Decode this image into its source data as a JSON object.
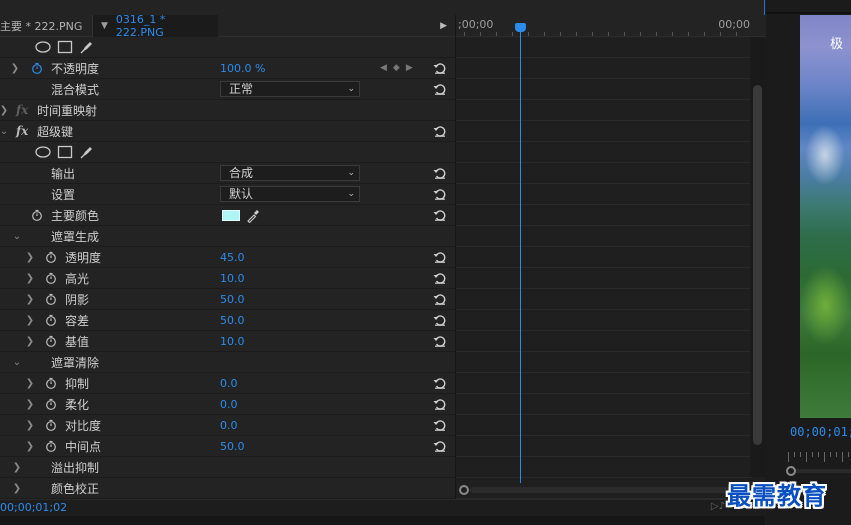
{
  "header": {
    "master_label": "主要 * 222.PNG",
    "clip_label": "0316_1 * 222.PNG"
  },
  "timeline": {
    "start_time": ";00;00",
    "end_time": "00;00"
  },
  "effects": {
    "opacity": {
      "label": "不透明度",
      "value": "100.0 %",
      "blend_label": "混合模式",
      "blend_value": "正常"
    },
    "time_remap": {
      "label": "时间重映射"
    },
    "ultra_key": {
      "label": "超级键",
      "output_label": "输出",
      "output_value": "合成",
      "setting_label": "设置",
      "setting_value": "默认",
      "key_color_label": "主要颜色",
      "key_color": "#aef6f6",
      "matte_gen": {
        "label": "遮罩生成",
        "params": [
          {
            "label": "透明度",
            "value": "45.0"
          },
          {
            "label": "高光",
            "value": "10.0"
          },
          {
            "label": "阴影",
            "value": "50.0"
          },
          {
            "label": "容差",
            "value": "50.0"
          },
          {
            "label": "基值",
            "value": "10.0"
          }
        ]
      },
      "matte_cleanup": {
        "label": "遮罩清除",
        "params": [
          {
            "label": "抑制",
            "value": "0.0"
          },
          {
            "label": "柔化",
            "value": "0.0"
          },
          {
            "label": "对比度",
            "value": "0.0"
          },
          {
            "label": "中间点",
            "value": "50.0"
          }
        ]
      },
      "spill_label": "溢出抑制",
      "color_correction_label": "颜色校正"
    }
  },
  "footer": {
    "timecode": "00;00;01;02"
  },
  "program_monitor": {
    "timecode": "00;00;01;",
    "overlay_text": "极"
  },
  "watermark": "最需教育",
  "colors": {
    "accent": "#2d8ceb",
    "panel": "#232323"
  }
}
